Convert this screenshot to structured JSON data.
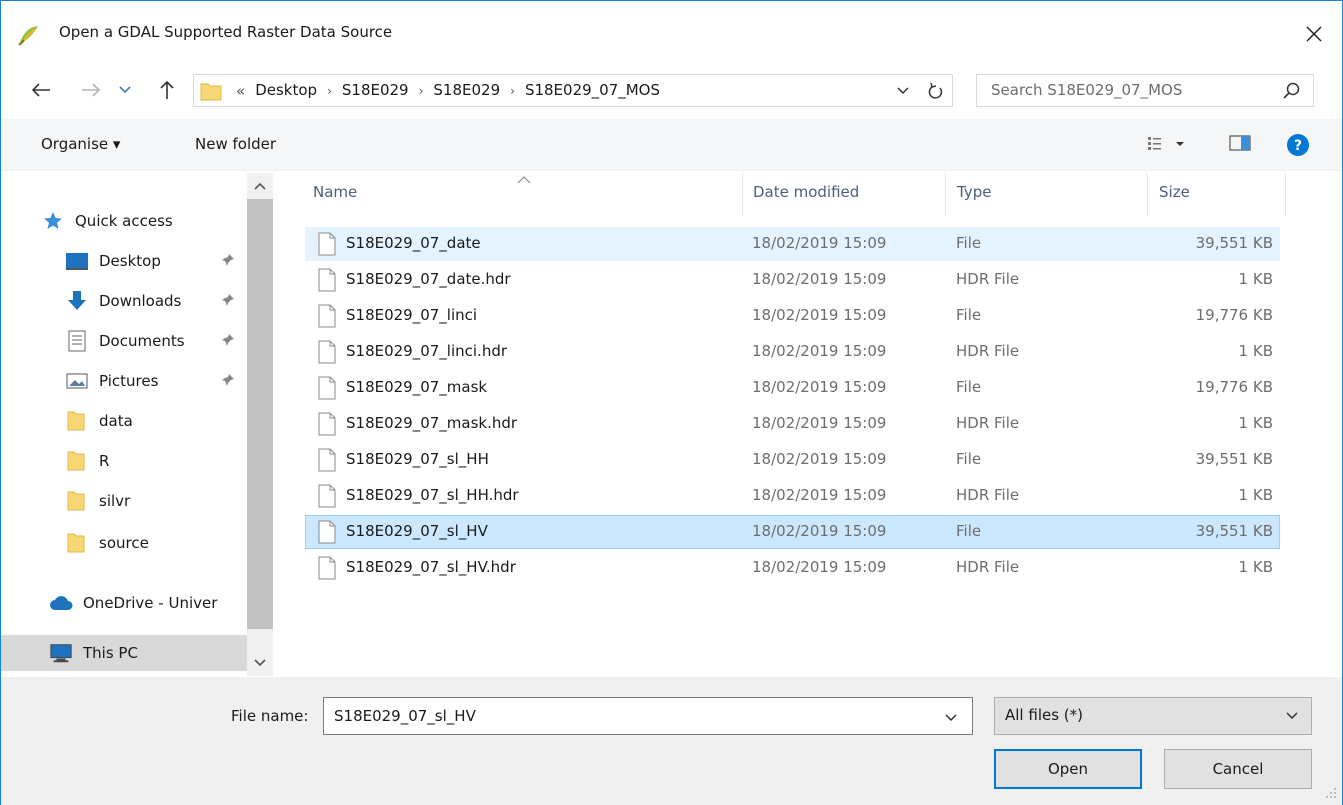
{
  "window": {
    "title": "Open a GDAL Supported Raster Data Source",
    "close_label": "✕"
  },
  "address": {
    "overflow": "«",
    "crumbs": [
      "Desktop",
      "S18E029",
      "S18E029",
      "S18E029_07_MOS"
    ],
    "search_placeholder": "Search S18E029_07_MOS"
  },
  "toolbar": {
    "organise_label": "Organise ▾",
    "new_folder_label": "New folder"
  },
  "nav": {
    "items": [
      {
        "label": "Quick access",
        "icon": "star-icon"
      },
      {
        "label": "Desktop",
        "icon": "desktop-icon",
        "pinned": true
      },
      {
        "label": "Downloads",
        "icon": "download-arrow-icon",
        "pinned": true
      },
      {
        "label": "Documents",
        "icon": "documents-icon",
        "pinned": true
      },
      {
        "label": "Pictures",
        "icon": "pictures-icon",
        "pinned": true
      },
      {
        "label": "data",
        "icon": "folder-icon"
      },
      {
        "label": "R",
        "icon": "folder-icon"
      },
      {
        "label": "silvr",
        "icon": "folder-icon"
      },
      {
        "label": "source",
        "icon": "folder-icon"
      },
      {
        "label": "OneDrive - Univer",
        "icon": "cloud-icon"
      },
      {
        "label": "This PC",
        "icon": "computer-icon",
        "selected": true
      }
    ]
  },
  "columns": {
    "name": "Name",
    "date": "Date modified",
    "type": "Type",
    "size": "Size"
  },
  "files": [
    {
      "name": "S18E029_07_date",
      "date": "18/02/2019 15:09",
      "type": "File",
      "size": "39,551 KB",
      "state": "hover"
    },
    {
      "name": "S18E029_07_date.hdr",
      "date": "18/02/2019 15:09",
      "type": "HDR File",
      "size": "1 KB"
    },
    {
      "name": "S18E029_07_linci",
      "date": "18/02/2019 15:09",
      "type": "File",
      "size": "19,776 KB"
    },
    {
      "name": "S18E029_07_linci.hdr",
      "date": "18/02/2019 15:09",
      "type": "HDR File",
      "size": "1 KB"
    },
    {
      "name": "S18E029_07_mask",
      "date": "18/02/2019 15:09",
      "type": "File",
      "size": "19,776 KB"
    },
    {
      "name": "S18E029_07_mask.hdr",
      "date": "18/02/2019 15:09",
      "type": "HDR File",
      "size": "1 KB"
    },
    {
      "name": "S18E029_07_sl_HH",
      "date": "18/02/2019 15:09",
      "type": "File",
      "size": "39,551 KB"
    },
    {
      "name": "S18E029_07_sl_HH.hdr",
      "date": "18/02/2019 15:09",
      "type": "HDR File",
      "size": "1 KB"
    },
    {
      "name": "S18E029_07_sl_HV",
      "date": "18/02/2019 15:09",
      "type": "File",
      "size": "39,551 KB",
      "state": "selected"
    },
    {
      "name": "S18E029_07_sl_HV.hdr",
      "date": "18/02/2019 15:09",
      "type": "HDR File",
      "size": "1 KB"
    }
  ],
  "bottom": {
    "file_name_label": "File name:",
    "file_name_value": "S18E029_07_sl_HV",
    "filter_value": "All files (*)",
    "open_label": "Open",
    "cancel_label": "Cancel"
  },
  "colors": {
    "accent": "#0078d7",
    "selection": "#cce8ff",
    "hover": "#e5f3ff",
    "folder": "#f8d775"
  }
}
